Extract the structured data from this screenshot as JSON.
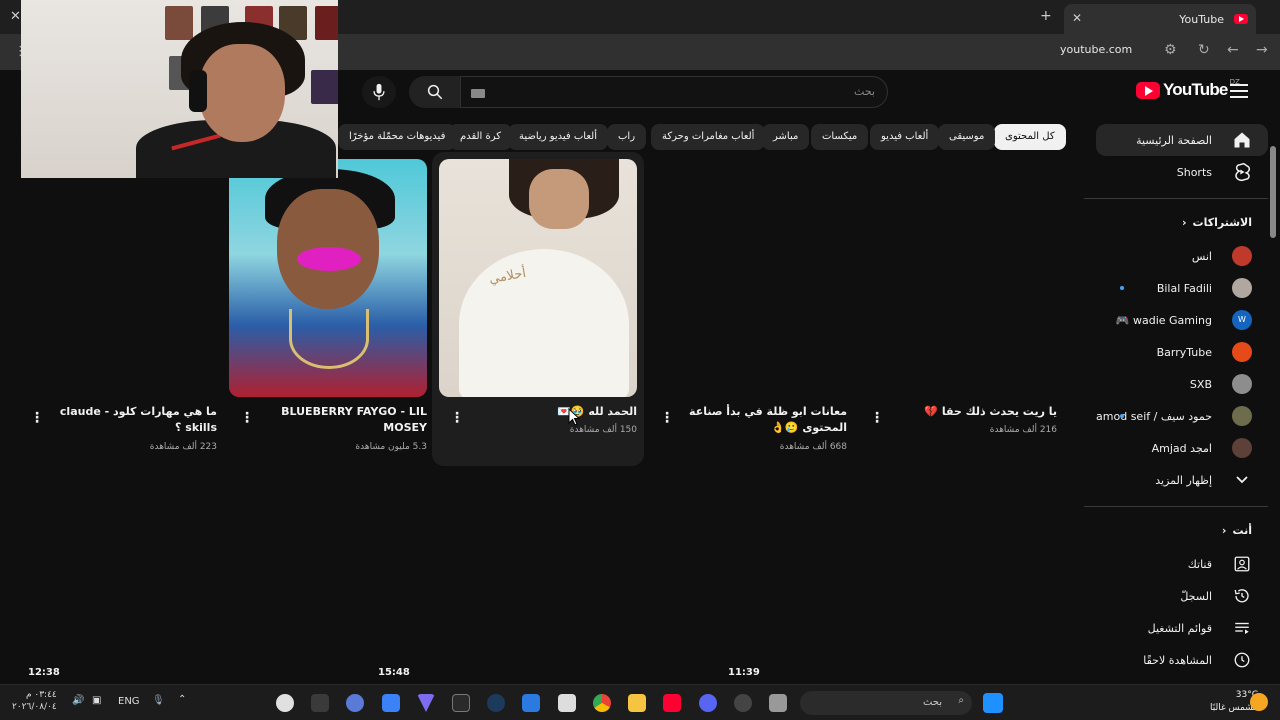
{
  "browser": {
    "tab_title": "YouTube",
    "url": "youtube.com",
    "new_tab": "+",
    "close_glyph": "✕"
  },
  "youtube": {
    "logo_text": "YouTube",
    "country_code": "DZ",
    "search_placeholder": "بحث"
  },
  "chips": [
    {
      "label": "كل المحتوى",
      "active": true
    },
    {
      "label": "موسيقى"
    },
    {
      "label": "ألعاب فيديو"
    },
    {
      "label": "ميكسات"
    },
    {
      "label": "مباشر"
    },
    {
      "label": "ألعاب مغامرات وحركة"
    },
    {
      "label": "راب"
    },
    {
      "label": "ألعاب فيديو رياضية"
    },
    {
      "label": "كرة القدم"
    },
    {
      "label": "فيديوهات محمّلة مؤخرًا"
    }
  ],
  "sidebar": {
    "home": "الصفحة الرئيسية",
    "shorts": "Shorts",
    "subscriptions": "الاشتراكات",
    "channels": [
      {
        "name": "انس",
        "color": "#c0392b",
        "new": false
      },
      {
        "name": "Bilal Fadili",
        "color": "#b0a8a0",
        "new": true
      },
      {
        "name": "wadie Gaming 🎮",
        "color": "#1565c0",
        "new": false
      },
      {
        "name": "BarryTube",
        "color": "#e64a19",
        "new": false
      },
      {
        "name": "SXB",
        "color": "#8d8d8d",
        "new": false
      },
      {
        "name": "حمود سيف / Hamod seif...",
        "color": "#6d6d4d",
        "new": true
      },
      {
        "name": "امجد Amjad",
        "color": "#5d4037",
        "new": false
      }
    ],
    "show_more": "إظهار المزيد",
    "you": "أنت",
    "you_items": [
      {
        "label": "قناتك",
        "icon": "channel-icon"
      },
      {
        "label": "السجلّ",
        "icon": "history-icon"
      },
      {
        "label": "قوائم التشغيل",
        "icon": "playlist-icon"
      },
      {
        "label": "المشاهدة لاحقًا",
        "icon": "watch-later-icon"
      }
    ]
  },
  "shorts": [
    {
      "title": "يا ريت يحدث ذلك حقا 💔",
      "views": "216 ألف مشاهدة"
    },
    {
      "title": "معانات ابو ظلة في بدأ صناعة المحتوى 🥲👌",
      "views": "668 ألف مشاهدة"
    },
    {
      "title": "الحمد لله 🥹💌",
      "views": "150 ألف مشاهدة"
    },
    {
      "title": "BLUEBERRY FAYGO - LIL MOSEY",
      "views": "5.3 مليون مشاهدة"
    },
    {
      "title": "ما هي مهارات كلود - claude skills ؟",
      "views": "223 ألف مشاهدة"
    }
  ],
  "thumb_text": "أحلامي",
  "video_timestamps": [
    "12:38",
    "15:48",
    "11:39"
  ],
  "taskbar": {
    "time": "٠٣:٤٤ م",
    "date": "٢٠٢٦/٠٨/٠٤",
    "language": "ENG",
    "search_placeholder": "بحث",
    "temperature": "33°C",
    "weather": "مشمس غالبًا"
  }
}
